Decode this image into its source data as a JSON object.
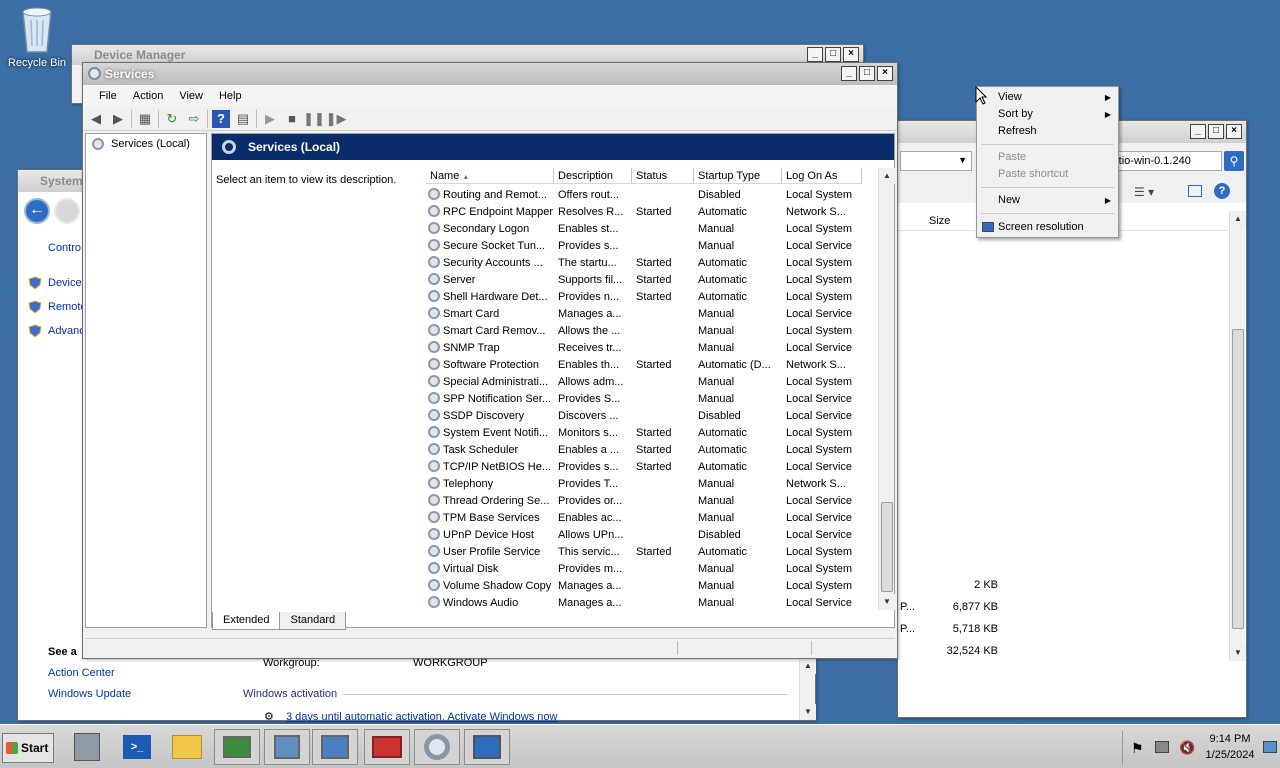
{
  "desktop": {
    "recycle_bin_label": "Recycle Bin"
  },
  "device_manager": {
    "title": "Device Manager"
  },
  "system_window": {
    "title": "System",
    "control_link": "Contro",
    "links": [
      "Device",
      "Remote",
      "Advanc"
    ],
    "see_also": "See a",
    "see_also_links": [
      "Action Center",
      "Windows Update"
    ],
    "workgroup_label": "Workgroup:",
    "workgroup_value": "WORKGROUP",
    "activation_header": "Windows activation",
    "activation_text": "3 days until automatic activation. Activate Windows now"
  },
  "explorer_window": {
    "address": "rtio-win-0.1.240",
    "size_header": "Size",
    "sizes": [
      {
        "prefix": "",
        "value": "2 KB"
      },
      {
        "prefix": "P...",
        "value": "6,877 KB"
      },
      {
        "prefix": "P...",
        "value": "5,718 KB"
      },
      {
        "prefix": "",
        "value": "32,524 KB"
      }
    ]
  },
  "services": {
    "title": "Services",
    "menu": [
      "File",
      "Action",
      "View",
      "Help"
    ],
    "tree_item": "Services (Local)",
    "panel_header": "Services (Local)",
    "description_prompt": "Select an item to view its description.",
    "columns": [
      "Name",
      "Description",
      "Status",
      "Startup Type",
      "Log On As"
    ],
    "rows": [
      [
        "Routing and Remot...",
        "Offers rout...",
        "",
        "Disabled",
        "Local System"
      ],
      [
        "RPC Endpoint Mapper",
        "Resolves R...",
        "Started",
        "Automatic",
        "Network S..."
      ],
      [
        "Secondary Logon",
        "Enables st...",
        "",
        "Manual",
        "Local System"
      ],
      [
        "Secure Socket Tun...",
        "Provides s...",
        "",
        "Manual",
        "Local Service"
      ],
      [
        "Security Accounts ...",
        "The startu...",
        "Started",
        "Automatic",
        "Local System"
      ],
      [
        "Server",
        "Supports fil...",
        "Started",
        "Automatic",
        "Local System"
      ],
      [
        "Shell Hardware Det...",
        "Provides n...",
        "Started",
        "Automatic",
        "Local System"
      ],
      [
        "Smart Card",
        "Manages a...",
        "",
        "Manual",
        "Local Service"
      ],
      [
        "Smart Card Remov...",
        "Allows the ...",
        "",
        "Manual",
        "Local System"
      ],
      [
        "SNMP Trap",
        "Receives tr...",
        "",
        "Manual",
        "Local Service"
      ],
      [
        "Software Protection",
        "Enables th...",
        "Started",
        "Automatic (D...",
        "Network S..."
      ],
      [
        "Special Administrati...",
        "Allows adm...",
        "",
        "Manual",
        "Local System"
      ],
      [
        "SPP Notification Ser...",
        "Provides S...",
        "",
        "Manual",
        "Local Service"
      ],
      [
        "SSDP Discovery",
        "Discovers ...",
        "",
        "Disabled",
        "Local Service"
      ],
      [
        "System Event Notifi...",
        "Monitors s...",
        "Started",
        "Automatic",
        "Local System"
      ],
      [
        "Task Scheduler",
        "Enables a ...",
        "Started",
        "Automatic",
        "Local System"
      ],
      [
        "TCP/IP NetBIOS He...",
        "Provides s...",
        "Started",
        "Automatic",
        "Local Service"
      ],
      [
        "Telephony",
        "Provides T...",
        "",
        "Manual",
        "Network S..."
      ],
      [
        "Thread Ordering Se...",
        "Provides or...",
        "",
        "Manual",
        "Local Service"
      ],
      [
        "TPM Base Services",
        "Enables ac...",
        "",
        "Manual",
        "Local Service"
      ],
      [
        "UPnP Device Host",
        "Allows UPn...",
        "",
        "Disabled",
        "Local Service"
      ],
      [
        "User Profile Service",
        "This servic...",
        "Started",
        "Automatic",
        "Local System"
      ],
      [
        "Virtual Disk",
        "Provides m...",
        "",
        "Manual",
        "Local System"
      ],
      [
        "Volume Shadow Copy",
        "Manages a...",
        "",
        "Manual",
        "Local System"
      ],
      [
        "Windows Audio",
        "Manages a...",
        "",
        "Manual",
        "Local Service"
      ]
    ],
    "tabs": [
      "Extended",
      "Standard"
    ]
  },
  "context_menu": {
    "view": "View",
    "sort_by": "Sort by",
    "refresh": "Refresh",
    "paste": "Paste",
    "paste_shortcut": "Paste shortcut",
    "new": "New",
    "screen_resolution": "Screen resolution"
  },
  "taskbar": {
    "start_label": "Start",
    "time": "9:14 PM",
    "date": "1/25/2024"
  },
  "colors": {
    "desktop": "#3b6ea5",
    "panel_header": "#0b2c6a",
    "link": "#0033aa"
  }
}
